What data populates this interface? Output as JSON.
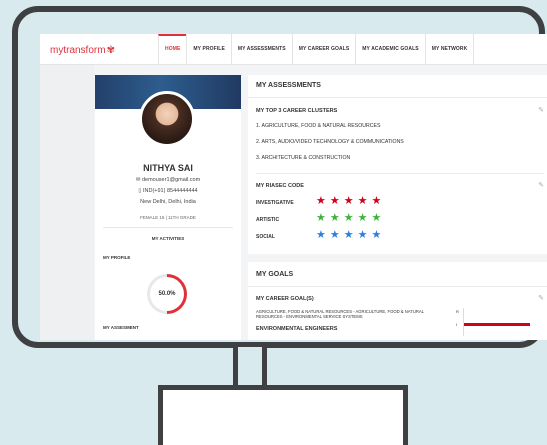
{
  "brand": {
    "logo_text": "mytransform",
    "logo_icon": "flower-icon",
    "accent": "#e0313a"
  },
  "nav": {
    "items": [
      "HOME",
      "MY PROFILE",
      "MY ASSESSMENTS",
      "MY CAREER GOALS",
      "MY ACADEMIC GOALS",
      "MY NETWORK"
    ],
    "active": "HOME"
  },
  "profile": {
    "name": "NITHYA SAI",
    "email": "demouser1@gmail.com",
    "phone": "IND(+91) 8544444444",
    "location": "New Delhi, Delhi, India",
    "meta": "FEMALE 16 | 11TH GRADE",
    "activities_label": "MY ACTIVITIES",
    "profile_label": "MY PROFILE",
    "progress": "50.0%",
    "progress_fraction": 0.5,
    "assessment_label": "MY ASSESMENT"
  },
  "assessments": {
    "title": "MY ASSESSMENTS",
    "clusters_title": "MY TOP 3 CAREER CLUSTERS",
    "clusters": [
      "1. AGRICULTURE, FOOD & NATURAL RESOURCES",
      "2. ARTS, AUDIO/VIDEO TECHNOLOGY & COMMUNICATIONS",
      "3. ARCHITECTURE & CONSTRUCTION"
    ],
    "riasec_title": "MY RIASEC CODE",
    "riasec": [
      {
        "label": "INVESTIGATIVE",
        "stars": 5,
        "color": "#d0021b"
      },
      {
        "label": "ARTISTIC",
        "stars": 5,
        "color": "#3cb43c"
      },
      {
        "label": "SOCIAL",
        "stars": 5,
        "color": "#2f7fd8"
      }
    ]
  },
  "goals": {
    "title": "MY GOALS",
    "career_title": "MY CAREER GOAL(S)",
    "goal_text": "AGRICULTURE, FOOD & NATURAL RESOURCES - AGRICULTURE, FOOD & NATURAL RESOURCES - ENVIRONMENTAL SERVICE SYSTEMS",
    "goal_name": "ENVIRONMENTAL ENGINEERS",
    "axis_labels": [
      "R",
      "I"
    ],
    "bar_color": "#d0021b"
  }
}
